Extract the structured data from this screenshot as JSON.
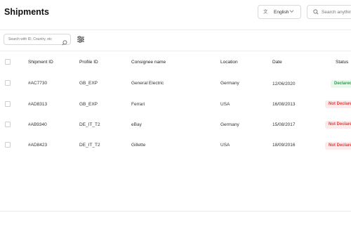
{
  "header": {
    "title": "Shipments",
    "language": "English",
    "search_placeholder": "Search anything"
  },
  "filters": {
    "search_placeholder": "Search with ID, Country, etc"
  },
  "table": {
    "columns": [
      "Shipment ID",
      "Profile ID",
      "Consignee name",
      "Location",
      "Date",
      "Status"
    ],
    "rows": [
      {
        "shipment_id": "#AC7730",
        "profile_id": "GB_EXP",
        "consignee": "General Electric",
        "location": "Germany",
        "date": "12/06/2020",
        "status": "Declared",
        "status_type": "ok"
      },
      {
        "shipment_id": "#AD8313",
        "profile_id": "GB_EXP",
        "consignee": "Ferrari",
        "location": "USA",
        "date": "16/08/2013",
        "status": "Not Declared",
        "status_type": "no"
      },
      {
        "shipment_id": "#AB9340",
        "profile_id": "DE_IT_T2",
        "consignee": "eBay",
        "location": "Germany",
        "date": "15/08/2017",
        "status": "Not Declared",
        "status_type": "no"
      },
      {
        "shipment_id": "#AD8423",
        "profile_id": "DE_IT_T2",
        "consignee": "Gillette",
        "location": "USA",
        "date": "18/09/2016",
        "status": "Not Declared",
        "status_type": "no"
      }
    ]
  },
  "colors": {
    "declared_text": "#22a447",
    "declared_bg": "#e8f8ec",
    "not_declared_text": "#e23c3c",
    "not_declared_bg": "#fdebeb"
  }
}
